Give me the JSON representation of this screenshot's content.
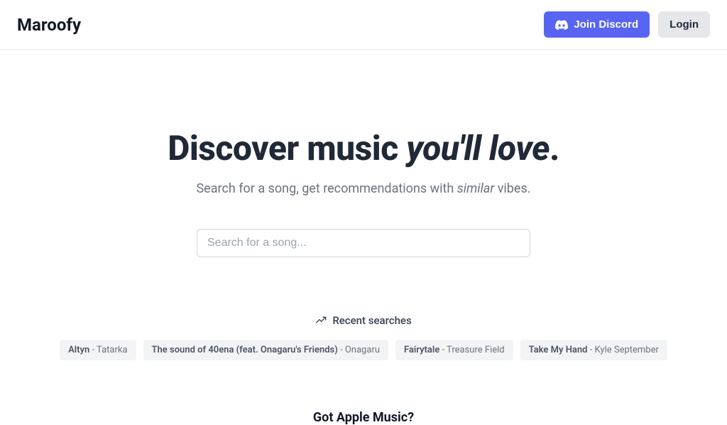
{
  "header": {
    "logo": "Maroofy",
    "discord_label": "Join Discord",
    "login_label": "Login"
  },
  "hero": {
    "title_part1": "Discover music ",
    "title_italic": "you'll love",
    "title_part2": ".",
    "subtitle_part1": "Search for a song, get recommendations with ",
    "subtitle_italic": "similar",
    "subtitle_part2": " vibes."
  },
  "search": {
    "placeholder": "Search for a song..."
  },
  "recent": {
    "heading": "Recent searches",
    "items": [
      {
        "song": "Altyn",
        "sep": " - ",
        "artist": "Tatarka"
      },
      {
        "song": "The sound of 40ena (feat. Onagaru's Friends)",
        "sep": " - ",
        "artist": "Onagaru"
      },
      {
        "song": "Fairytale",
        "sep": " - ",
        "artist": "Treasure Field"
      },
      {
        "song": "Take My Hand",
        "sep": " - ",
        "artist": "Kyle September"
      }
    ]
  },
  "apple": {
    "heading": "Got Apple Music?"
  }
}
